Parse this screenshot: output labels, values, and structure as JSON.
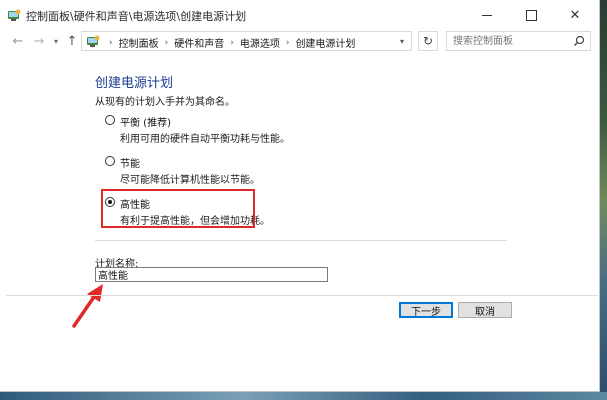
{
  "window": {
    "title": "控制面板\\硬件和声音\\电源选项\\创建电源计划",
    "buttons": {
      "minimize": "—",
      "maximize": "□",
      "close": "✕"
    }
  },
  "address": {
    "breadcrumbs": [
      "控制面板",
      "硬件和声音",
      "电源选项",
      "创建电源计划"
    ],
    "search_placeholder": "搜索控制面板"
  },
  "page": {
    "title": "创建电源计划",
    "subtitle": "从现有的计划入手并为其命名。",
    "plans": [
      {
        "name": "平衡 (推荐)",
        "description": "利用可用的硬件自动平衡功耗与性能。",
        "selected": false
      },
      {
        "name": "节能",
        "description": "尽可能降低计算机性能以节能。",
        "selected": false
      },
      {
        "name": "高性能",
        "description": "有利于提高性能，但会增加功耗。",
        "selected": true
      }
    ],
    "plan_name_label": "计划名称:",
    "plan_name_value": "高性能"
  },
  "footer": {
    "next_label": "下一步",
    "cancel_label": "取消"
  },
  "icons": {
    "app": "control-panel-icon",
    "search": "search-icon",
    "refresh": "refresh-icon"
  },
  "colors": {
    "title_blue": "#1e3d91",
    "highlight_red": "#e02929",
    "default_button_border": "#0078d7"
  }
}
